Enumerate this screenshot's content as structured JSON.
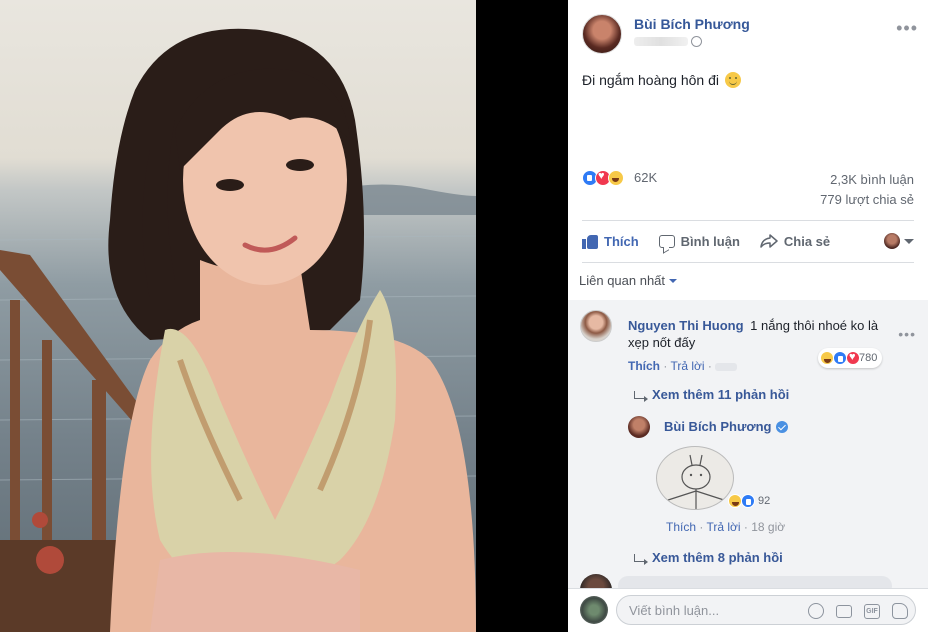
{
  "post": {
    "author": "Bùi Bích Phương",
    "text": "Đi ngắm hoàng hôn đi",
    "reaction_count": "62K",
    "comments_count": "2,3K bình luận",
    "shares_count": "779 lượt chia sẻ"
  },
  "actions": {
    "like": "Thích",
    "comment": "Bình luận",
    "share": "Chia sẻ"
  },
  "sort_label": "Liên quan nhất",
  "comments": [
    {
      "author": "Nguyen Thi Huong",
      "text": "1 nắng thôi nhoé ko là xẹp nốt đấy",
      "reaction_count": "780",
      "like_label": "Thích",
      "reply_label": "Trả lời",
      "more_replies": "Xem thêm 11 phản hồi",
      "reply": {
        "author": "Bùi Bích Phương",
        "reaction_count": "92",
        "like_label": "Thích",
        "reply_label": "Trả lời",
        "time": "18 giờ"
      }
    }
  ],
  "more_replies_2": "Xem thêm 8 phản hồi",
  "composer": {
    "placeholder": "Viết bình luận..."
  },
  "colors": {
    "link": "#385898",
    "accent": "#4267b2",
    "muted": "#90949c"
  }
}
